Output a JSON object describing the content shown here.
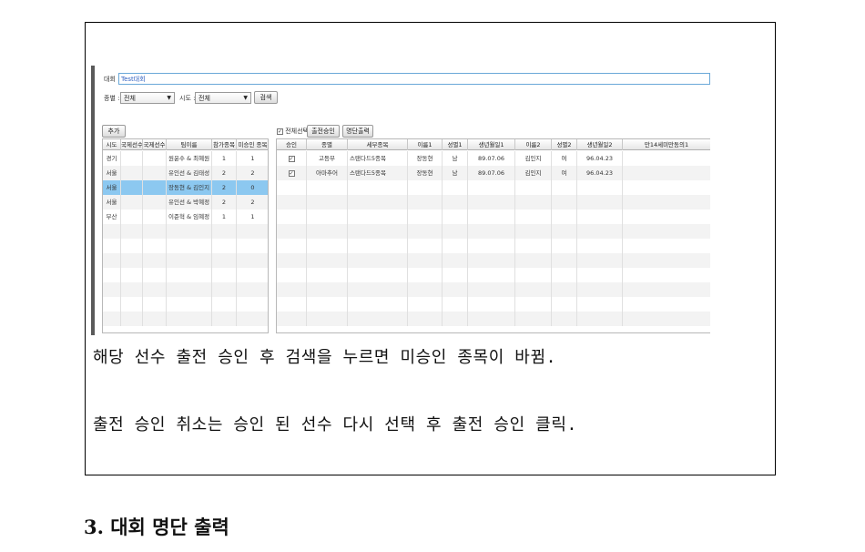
{
  "filter": {
    "title_label": "대회 :",
    "title_value": "Test대회",
    "category_label": "종별 :",
    "category_value": "전체",
    "region_label": "시도 :",
    "region_value": "전체",
    "search_label": "검색"
  },
  "left_panel": {
    "add_label": "추가",
    "headers": [
      "시도",
      "국제선수",
      "국제선수",
      "팀이름",
      "참가종목",
      "미승인 종목"
    ],
    "rows": [
      {
        "region": "경기",
        "team": "원윤수 & 최혜원",
        "entered": "1",
        "unapproved": "1"
      },
      {
        "region": "서울",
        "team": "유인선 & 김태성",
        "entered": "2",
        "unapproved": "2"
      },
      {
        "region": "서울",
        "team": "장동현 & 김인지",
        "entered": "2",
        "unapproved": "0"
      },
      {
        "region": "서울",
        "team": "유인선 & 박혜정",
        "entered": "2",
        "unapproved": "2"
      },
      {
        "region": "부산",
        "team": "이준혁 & 임혜정",
        "entered": "1",
        "unapproved": "1"
      }
    ],
    "selected_row": 2
  },
  "right_panel": {
    "select_all_label": "전체선택",
    "approve_label": "출전승인",
    "print_label": "명단출력",
    "headers": [
      "승인",
      "종별",
      "세부종목",
      "이름1",
      "성별1",
      "생년월일1",
      "이름2",
      "성별2",
      "생년월일2",
      "만14세미만동의1"
    ],
    "rows": [
      {
        "approved": "✓",
        "division": "고등부",
        "event": "스탠다드5종목",
        "name1": "장동현",
        "gender1": "남",
        "birth1": "89.07.06",
        "name2": "김인지",
        "gender2": "여",
        "birth2": "96.04.23"
      },
      {
        "approved": "✓",
        "division": "아마추어",
        "event": "스탠다드5종목",
        "name1": "장동현",
        "gender1": "남",
        "birth1": "89.07.06",
        "name2": "김인지",
        "gender2": "여",
        "birth2": "96.04.23"
      }
    ]
  },
  "captions": {
    "line1": "해당 선수 출전 승인 후 검색을 누르면 미승인 종목이 바뀜.",
    "line2": "출전 승인 취소는 승인 된 선수 다시 선택 후 출전 승인 클릭."
  },
  "section_heading": "3. 대회 명단 출력"
}
